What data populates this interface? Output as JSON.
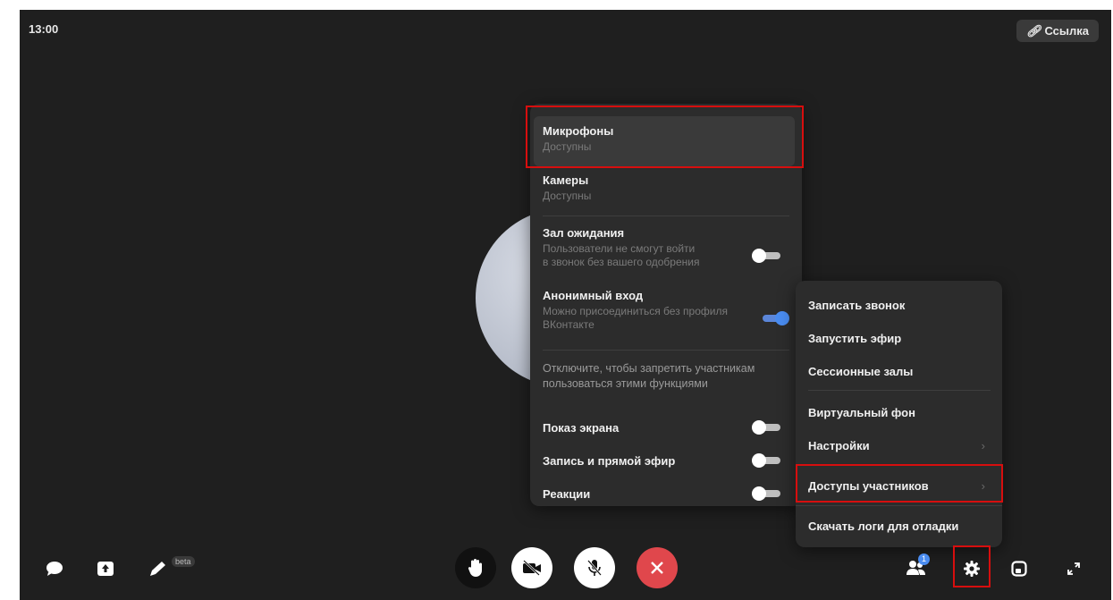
{
  "top": {
    "time": "13:00",
    "link_label": "Ссылка"
  },
  "access_menu": {
    "microphones": {
      "title": "Микрофоны",
      "status": "Доступны"
    },
    "cameras": {
      "title": "Камеры",
      "status": "Доступны"
    },
    "waiting_room": {
      "title": "Зал ожидания",
      "desc_line1": "Пользователи не смогут войти",
      "desc_line2": "в звонок без вашего одобрения",
      "enabled": false
    },
    "anonymous": {
      "title": "Анонимный вход",
      "desc_line1": "Можно присоединиться без профиля",
      "desc_line2": "ВКонтакте",
      "enabled": true
    },
    "note_line1": "Отключите, чтобы запретить участникам",
    "note_line2": "пользоваться этими функциями",
    "screen_share": {
      "title": "Показ экрана",
      "enabled": false
    },
    "recording": {
      "title": "Запись и прямой эфир",
      "enabled": false
    },
    "reactions": {
      "title": "Реакции",
      "enabled": false
    }
  },
  "settings_menu": {
    "record_call": "Записать звонок",
    "start_stream": "Запустить эфир",
    "session_rooms": "Сессионные залы",
    "virtual_bg": "Виртуальный фон",
    "settings": "Настройки",
    "participant_access": "Доступы участников",
    "download_logs": "Скачать логи для отладки"
  },
  "bottom_bar": {
    "beta_label": "beta",
    "participants_count": "1",
    "icons": [
      "chat-icon",
      "share-screen-icon",
      "draw-icon",
      "raise-hand-icon",
      "camera-off-icon",
      "mic-off-icon",
      "end-call-icon",
      "participants-icon",
      "settings-icon",
      "layout-icon",
      "fullscreen-icon"
    ],
    "end_call_color": "#e0474c"
  }
}
